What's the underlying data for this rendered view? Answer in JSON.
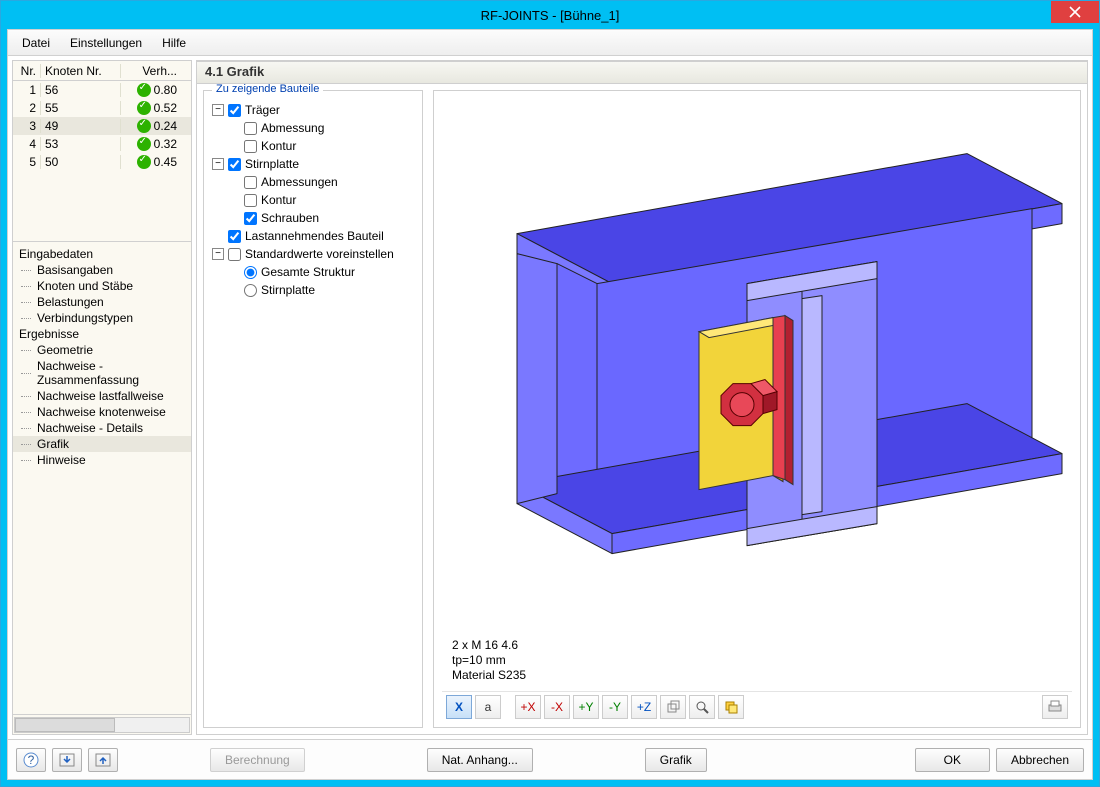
{
  "window": {
    "title": "RF-JOINTS - [Bühne_1]"
  },
  "menu": {
    "file": "Datei",
    "settings": "Einstellungen",
    "help": "Hilfe"
  },
  "table": {
    "head": {
      "nr": "Nr.",
      "knoten": "Knoten Nr.",
      "verh": "Verh..."
    },
    "rows": [
      {
        "nr": "1",
        "knoten": "56",
        "verh": "0.80"
      },
      {
        "nr": "2",
        "knoten": "55",
        "verh": "0.52"
      },
      {
        "nr": "3",
        "knoten": "49",
        "verh": "0.24"
      },
      {
        "nr": "4",
        "knoten": "53",
        "verh": "0.32"
      },
      {
        "nr": "5",
        "knoten": "50",
        "verh": "0.45"
      }
    ],
    "selected_index": 2
  },
  "nav": {
    "sections": [
      {
        "title": "Eingabedaten",
        "items": [
          "Basisangaben",
          "Knoten und Stäbe",
          "Belastungen",
          "Verbindungstypen"
        ]
      },
      {
        "title": "Ergebnisse",
        "items": [
          "Geometrie",
          "Nachweise - Zusammenfassung",
          "Nachweise lastfallweise",
          "Nachweise knotenweise",
          "Nachweise - Details",
          "Grafik",
          "Hinweise"
        ]
      }
    ],
    "selected": "Grafik"
  },
  "panel": {
    "title": "4.1 Grafik"
  },
  "tree": {
    "legend": "Zu zeigende Bauteile",
    "nodes": {
      "traeger": "Träger",
      "abmessung": "Abmessung",
      "kontur": "Kontur",
      "stirnplatte": "Stirnplatte",
      "abmessungen": "Abmessungen",
      "kontur2": "Kontur",
      "schrauben": "Schrauben",
      "lastannehm": "Lastannehmendes Bauteil",
      "standardwerte": "Standardwerte voreinstellen",
      "gesamte": "Gesamte Struktur",
      "stirnplatte_r": "Stirnplatte"
    }
  },
  "viewer": {
    "info_lines": [
      "2 x M 16 4.6",
      "tp=10 mm",
      "Material S235"
    ]
  },
  "viewer_toolbar": {
    "btns": [
      "X",
      "a",
      "+X",
      "-X",
      "+Y",
      "-Y",
      "+Z",
      "iso",
      "mag",
      "copy"
    ],
    "print": "print"
  },
  "footer": {
    "help": "?",
    "import": "⇱",
    "export": "⇲",
    "calc": "Berechnung",
    "nat_anhang": "Nat. Anhang...",
    "grafik": "Grafik",
    "ok": "OK",
    "cancel": "Abbrechen"
  }
}
